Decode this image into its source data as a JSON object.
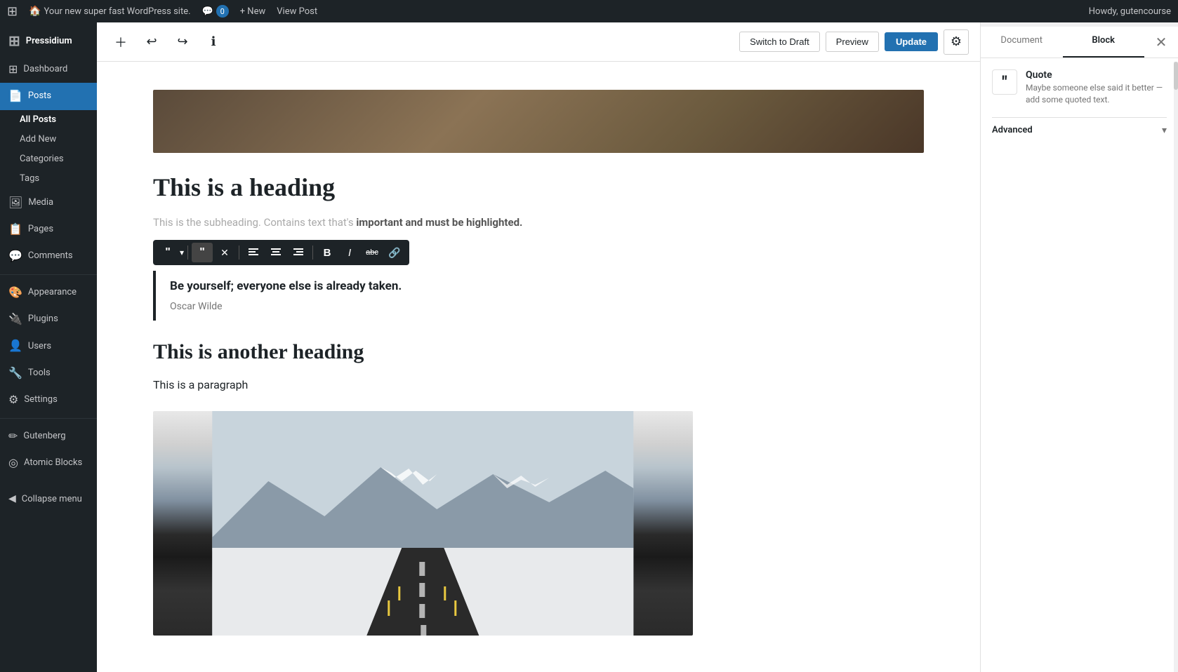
{
  "adminbar": {
    "logo": "⊞",
    "site_name": "Your new super fast WordPress site.",
    "comments_count": "0",
    "new_label": "+ New",
    "view_post_label": "View Post",
    "howdy": "Howdy, gutencourse"
  },
  "sidebar": {
    "brand": "Pressidium",
    "items": [
      {
        "id": "dashboard",
        "label": "Dashboard",
        "icon": "⊞"
      },
      {
        "id": "posts",
        "label": "Posts",
        "icon": "📄",
        "active": true
      },
      {
        "id": "all-posts",
        "label": "All Posts",
        "sub": true
      },
      {
        "id": "add-new",
        "label": "Add New",
        "sub": true
      },
      {
        "id": "categories",
        "label": "Categories",
        "sub": true
      },
      {
        "id": "tags",
        "label": "Tags",
        "sub": true
      },
      {
        "id": "media",
        "label": "Media",
        "icon": "🖼"
      },
      {
        "id": "pages",
        "label": "Pages",
        "icon": "📋"
      },
      {
        "id": "comments",
        "label": "Comments",
        "icon": "💬"
      },
      {
        "id": "appearance",
        "label": "Appearance",
        "icon": "🎨"
      },
      {
        "id": "plugins",
        "label": "Plugins",
        "icon": "🔌"
      },
      {
        "id": "users",
        "label": "Users",
        "icon": "👤"
      },
      {
        "id": "tools",
        "label": "Tools",
        "icon": "🔧"
      },
      {
        "id": "settings",
        "label": "Settings",
        "icon": "⚙"
      },
      {
        "id": "gutenberg",
        "label": "Gutenberg",
        "icon": "✏"
      },
      {
        "id": "atomic-blocks",
        "label": "Atomic Blocks",
        "icon": "◎"
      }
    ],
    "collapse_label": "Collapse menu"
  },
  "toolbar": {
    "add_block_title": "Add block",
    "undo_title": "Undo",
    "redo_title": "Redo",
    "block_info_title": "Block info",
    "switch_draft_label": "Switch to Draft",
    "preview_label": "Preview",
    "update_label": "Update",
    "settings_title": "Settings"
  },
  "editor": {
    "heading1": "This is a heading",
    "subheading_prefix": "This is the subheading. Contains text that's",
    "subheading_highlight": "important and must be highlighted.",
    "quote_text": "Be yourself; everyone else is already taken.",
    "quote_cite": "Oscar Wilde",
    "heading2": "This is another heading",
    "paragraph": "This is a paragraph"
  },
  "block_toolbar": {
    "quote_icon": "❝",
    "dropdown_arrow": "▾",
    "style_btn": "❝",
    "remove_btn": "✕",
    "align_left": "≡",
    "align_center": "≡",
    "align_right": "≡",
    "bold": "B",
    "italic": "I",
    "strikethrough": "abc",
    "link": "🔗"
  },
  "right_panel": {
    "document_tab": "Document",
    "block_tab": "Block",
    "block_name": "Quote",
    "block_description": "Maybe someone else said it better — add some quoted text.",
    "advanced_label": "Advanced",
    "close_icon": "✕"
  },
  "colors": {
    "admin_bar_bg": "#1d2327",
    "sidebar_bg": "#1d2327",
    "active_menu_bg": "#2271b1",
    "update_btn_bg": "#2271b1",
    "panel_active_tab_border": "#1d2327"
  }
}
